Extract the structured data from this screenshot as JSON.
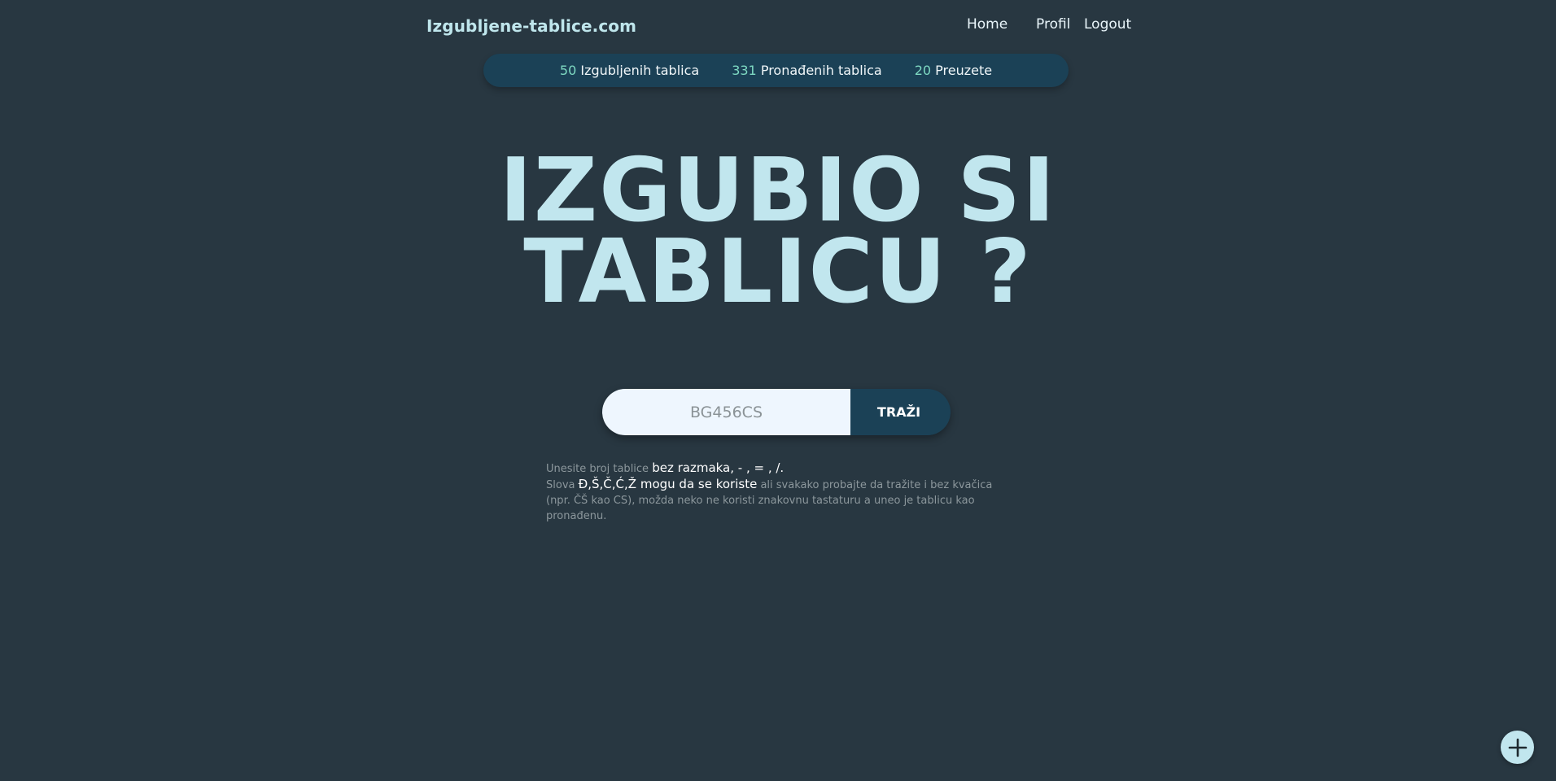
{
  "header": {
    "brand": "Izgubljene-tablice.com",
    "nav": {
      "home": "Home",
      "profil": "Profil",
      "logout": "Logout"
    }
  },
  "stats": [
    {
      "value": "50",
      "label": "Izgubljenih tablica"
    },
    {
      "value": "331",
      "label": "Pronađenih tablica"
    },
    {
      "value": "20",
      "label": "Preuzete"
    }
  ],
  "hero": {
    "line1": "IZGUBIO SI",
    "line2": "TABLICU ?"
  },
  "search": {
    "placeholder": "BG456CS",
    "value": "",
    "button_label": "TRAŽI"
  },
  "help": {
    "line1_muted": "Unesite broj tablice",
    "line1_em": "bez razmaka, - , = , /.",
    "line2_muted_a": "Slova",
    "line2_em": "Đ,Š,Č,Ć,Ž mogu da se koriste",
    "line2_muted_b": "ali svakako probajte da tražite i bez kvačica (npr. ČŠ kao CS), možda neko ne koristi znakovnu tastaturu a uneo je tablicu kao pronađenu."
  },
  "fab": {
    "icon": "plus-icon",
    "glyph": "+"
  },
  "colors": {
    "background": "#283741",
    "accent": "#1b4156",
    "hero_text": "#c1e6ee",
    "stat_number": "#7ed9c2"
  }
}
